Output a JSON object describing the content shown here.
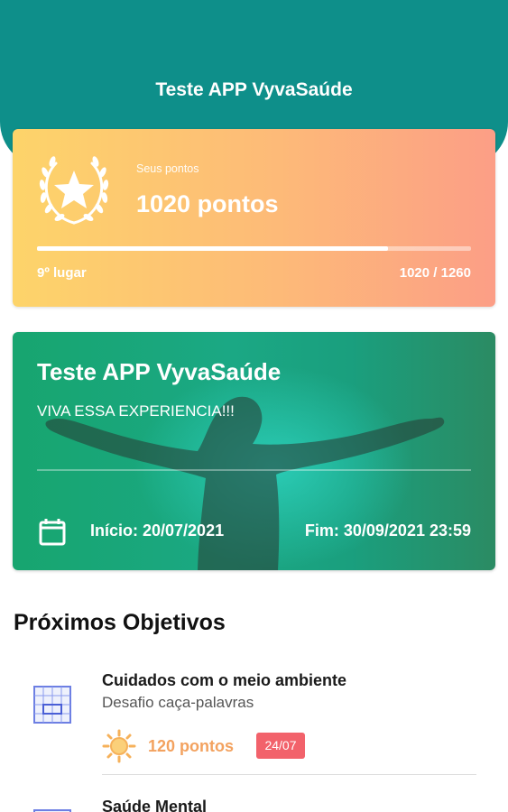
{
  "header": {
    "title": "Teste APP VyvaSaúde",
    "color": "#0e8f8a"
  },
  "points_card": {
    "caption": "Seus pontos",
    "points_label": "1020 pontos",
    "rank_label": "9º lugar",
    "progress_text": "1020 / 1260",
    "progress_current": 1020,
    "progress_total": 1260,
    "icon": "laurel-star-icon"
  },
  "challenge": {
    "title": "Teste APP VyvaSaúde",
    "subtitle": "VIVA ESSA EXPERIENCIA!!!",
    "start_label": "Início: 20/07/2021",
    "end_label": "Fim: 30/09/2021 23:59",
    "icon": "calendar-icon"
  },
  "objectives_section": {
    "title": "Próximos Objetivos",
    "items": [
      {
        "title": "Cuidados com o meio ambiente",
        "subtitle": "Desafio caça-palavras",
        "points_label": "120 pontos",
        "date_badge": "24/07",
        "icon": "word-search-grid-icon",
        "points_icon": "sun-icon"
      },
      {
        "title": "Saúde Mental",
        "icon": "word-search-grid-icon"
      }
    ]
  },
  "colors": {
    "points_gradient_start": "#fdd46a",
    "points_gradient_end": "#fc9e86",
    "points_text": "#f3a25f",
    "badge": "#f2626b"
  }
}
